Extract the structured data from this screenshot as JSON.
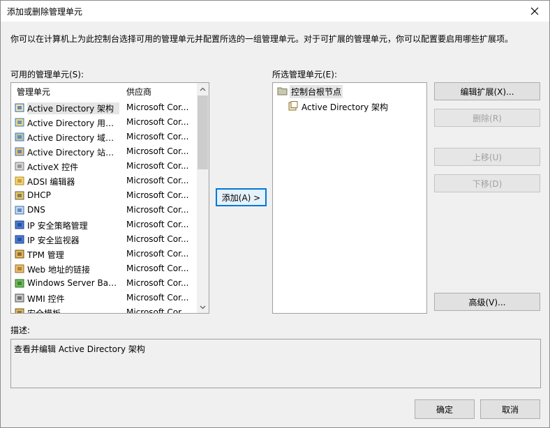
{
  "window": {
    "title": "添加或删除管理单元",
    "intro": "你可以在计算机上为此控制台选择可用的管理单元并配置所选的一组管理单元。对于可扩展的管理单元，你可以配置要启用哪些扩展项。"
  },
  "available": {
    "label": "可用的管理单元(S):",
    "col_name": "管理单元",
    "col_vendor": "供应商",
    "items": [
      {
        "name": "Active Directory 架构",
        "vendor": "Microsoft Cor...",
        "icon": "schema-icon",
        "selected": true
      },
      {
        "name": "Active Directory 用户...",
        "vendor": "Microsoft Cor...",
        "icon": "users-icon"
      },
      {
        "name": "Active Directory 域和...",
        "vendor": "Microsoft Cor...",
        "icon": "domains-icon"
      },
      {
        "name": "Active Directory 站点...",
        "vendor": "Microsoft Cor...",
        "icon": "sites-icon"
      },
      {
        "name": "ActiveX 控件",
        "vendor": "Microsoft Cor...",
        "icon": "activex-icon"
      },
      {
        "name": "ADSI 编辑器",
        "vendor": "Microsoft Cor...",
        "icon": "adsi-icon"
      },
      {
        "name": "DHCP",
        "vendor": "Microsoft Cor...",
        "icon": "dhcp-icon"
      },
      {
        "name": "DNS",
        "vendor": "Microsoft Cor...",
        "icon": "dns-icon"
      },
      {
        "name": "IP 安全策略管理",
        "vendor": "Microsoft Cor...",
        "icon": "ipsec-policy-icon"
      },
      {
        "name": "IP 安全监视器",
        "vendor": "Microsoft Cor...",
        "icon": "ipsec-monitor-icon"
      },
      {
        "name": "TPM 管理",
        "vendor": "Microsoft Cor...",
        "icon": "tpm-icon"
      },
      {
        "name": "Web 地址的链接",
        "vendor": "Microsoft Cor...",
        "icon": "web-link-icon"
      },
      {
        "name": "Windows Server Bac...",
        "vendor": "Microsoft Cor...",
        "icon": "backup-icon"
      },
      {
        "name": "WMI 控件",
        "vendor": "Microsoft Cor...",
        "icon": "wmi-icon"
      },
      {
        "name": "安全模板",
        "vendor": "Microsoft Cor...",
        "icon": "security-template-icon"
      }
    ]
  },
  "add_button": "添加(A) >",
  "selected": {
    "label": "所选管理单元(E):",
    "root": "控制台根节点",
    "child": "Active Directory 架构"
  },
  "right_buttons": {
    "edit_ext": "编辑扩展(X)...",
    "remove": "删除(R)",
    "move_up": "上移(U)",
    "move_down": "下移(D)",
    "advanced": "高级(V)..."
  },
  "description": {
    "label": "描述:",
    "text": "查看并编辑 Active Directory 架构"
  },
  "footer": {
    "ok": "确定",
    "cancel": "取消"
  },
  "colors": {
    "dialog_bg": "#f0f0f0",
    "button_bg": "#e1e1e1",
    "default_border": "#0078d7",
    "disabled_text": "#a0a0a0"
  }
}
